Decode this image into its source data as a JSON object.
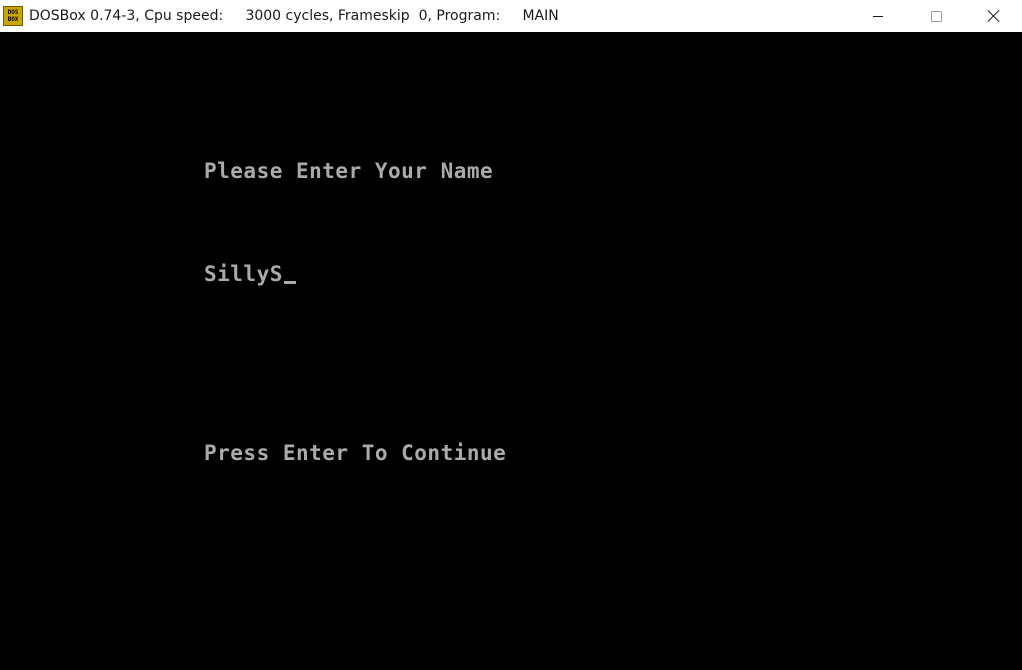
{
  "window": {
    "app_icon_text": "DOS BOX",
    "title": "DOSBox 0.74-3, Cpu speed:     3000 cycles, Frameskip  0, Program:     MAIN",
    "icons": {
      "app": "dosbox-icon",
      "minimize": "minimize-icon",
      "maximize": "maximize-icon",
      "close": "close-icon"
    }
  },
  "screen": {
    "prompt": "Please Enter Your Name",
    "input_value": "SillyS",
    "continue_text": "Press Enter To Continue",
    "text_color": "#aaaaaa",
    "background_color": "#000000"
  }
}
